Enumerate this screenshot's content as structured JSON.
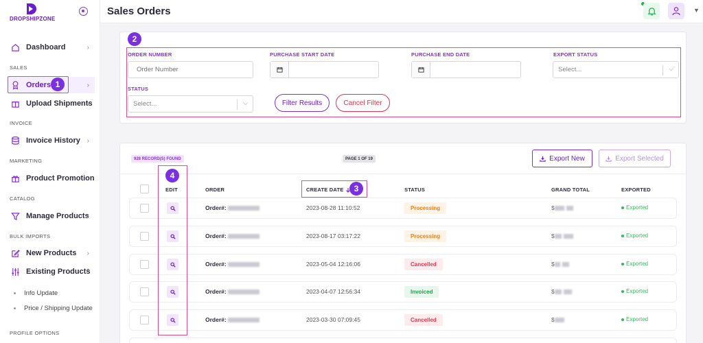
{
  "brand": {
    "name": "DROPSHIPZONE",
    "color": "#6a1bd0"
  },
  "header": {
    "title": "Sales Orders"
  },
  "sidebar": {
    "sections": {
      "sales": "SALES",
      "invoice": "INVOICE",
      "marketing": "MARKETING",
      "catalog": "CATALOG",
      "bulk": "BULK IMPORTS",
      "profile": "PROFILE OPTIONS"
    },
    "items": {
      "dashboard": "Dashboard",
      "orders": "Orders",
      "upload": "Upload Shipments",
      "invoice_history": "Invoice History",
      "product_promotion": "Product Promotion",
      "manage_products": "Manage Products",
      "new_products": "New Products",
      "existing_products": "Existing Products",
      "info_update": "Info Update",
      "price_update": "Price / Shipping Update"
    }
  },
  "annotations": [
    "1",
    "2",
    "3",
    "4"
  ],
  "filters": {
    "order_number": {
      "label": "ORDER NUMBER",
      "placeholder": "Order Number"
    },
    "start_date": {
      "label": "PURCHASE START DATE"
    },
    "end_date": {
      "label": "PURCHASE END DATE"
    },
    "export_status": {
      "label": "EXPORT STATUS",
      "placeholder": "Select..."
    },
    "status": {
      "label": "STATUS",
      "placeholder": "Select..."
    },
    "filter_button": "Filter Results",
    "cancel_button": "Cancel Filter"
  },
  "table": {
    "records": "928 RECORD(S) FOUND",
    "page": "PAGE 1 OF 19",
    "export_new": "Export New",
    "export_selected": "Export Selected",
    "columns": {
      "edit": "EDIT",
      "order": "ORDER",
      "create_date": "CREATE DATE",
      "status": "STATUS",
      "grand_total": "GRAND TOTAL",
      "exported": "EXPORTED"
    },
    "order_prefix": "Order#:",
    "currency": "$",
    "rows": [
      {
        "date": "2023-08-28 11:10:52",
        "status": "Processing",
        "exported": "Exported"
      },
      {
        "date": "2023-08-17 03:17:22",
        "status": "Processing",
        "exported": "Exported"
      },
      {
        "date": "2023-05-04 12:16:06",
        "status": "Cancelled",
        "exported": "Exported"
      },
      {
        "date": "2023-04-07 12:56:34",
        "status": "Invoiced",
        "exported": "Exported"
      },
      {
        "date": "2023-03-30 07:09:45",
        "status": "Cancelled",
        "exported": "Exported"
      }
    ]
  },
  "colors": {
    "accent": "#7b2fe3",
    "processing_bg": "#fff3e6",
    "processing_fg": "#f07d1a",
    "cancelled_bg": "#fdecee",
    "cancelled_fg": "#e5334b",
    "invoiced_bg": "#e6f8ec",
    "invoiced_fg": "#21a04a"
  }
}
